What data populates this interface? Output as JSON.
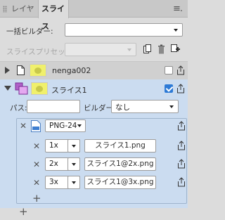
{
  "tabs": [
    {
      "label": "レイヤ",
      "active": false
    },
    {
      "label": "スライス",
      "active": true
    }
  ],
  "batch_builder": {
    "label": "一括ビルダー:",
    "value": ""
  },
  "slice_preset": {
    "label": "スライスプリセット:",
    "value": "",
    "disabled": true
  },
  "layers": [
    {
      "name": "nenga002",
      "checked": false,
      "expanded": false
    },
    {
      "name": "スライス1",
      "checked": true,
      "expanded": true
    }
  ],
  "slice_detail": {
    "path_label": "パス:",
    "path_value": "",
    "builder_label": "ビルダー:",
    "builder_value": "なし",
    "format": "PNG-24",
    "scales": [
      {
        "scale": "1x",
        "filename": "スライス1.png"
      },
      {
        "scale": "2x",
        "filename": "スライス1@2x.png"
      },
      {
        "scale": "3x",
        "filename": "スライス1@3x.png"
      }
    ]
  },
  "icons": {
    "menu": "hamburger-icon",
    "remove": "close-icon",
    "add": "plus-icon",
    "export": "export-icon"
  },
  "colors": {
    "accent": "#2d7ad6",
    "selected_row": "#cbdcf0",
    "thumb": "#f0f06c"
  }
}
